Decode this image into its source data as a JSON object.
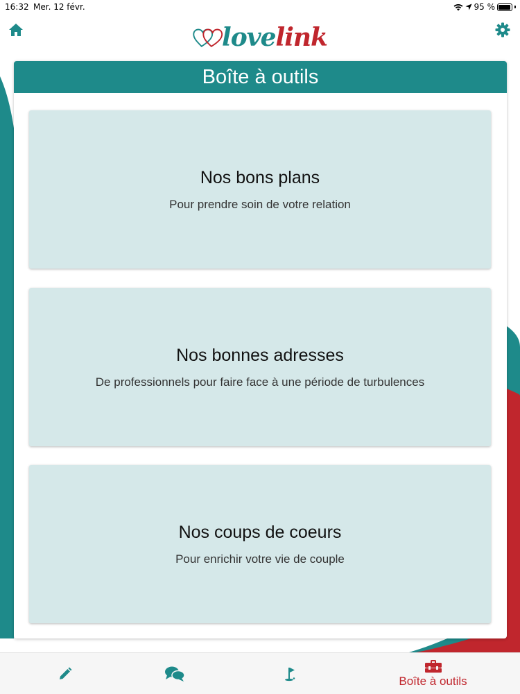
{
  "status_bar": {
    "time": "16:32",
    "date": "Mer. 12 févr.",
    "battery": "95 %",
    "battery_level": 0.95
  },
  "header": {
    "logo_love": "love",
    "logo_link": "link",
    "icons": {
      "left": "home-icon",
      "right": "gear-icon"
    }
  },
  "panel": {
    "title": "Boîte à outils"
  },
  "cards": [
    {
      "title": "Nos bons plans",
      "subtitle": "Pour prendre soin de votre relation"
    },
    {
      "title": "Nos bonnes adresses",
      "subtitle": "De professionnels pour faire face à une période de turbulences"
    },
    {
      "title": "Nos coups de coeurs",
      "subtitle": "Pour enrichir votre vie de couple"
    }
  ],
  "tabbar": {
    "tabs": [
      {
        "icon": "pencil-icon",
        "label": ""
      },
      {
        "icon": "chat-icon",
        "label": ""
      },
      {
        "icon": "golf-flag-icon",
        "label": ""
      },
      {
        "icon": "toolbox-icon",
        "label": "Boîte à outils",
        "active": true
      }
    ]
  },
  "colors": {
    "teal": "#1e8a8a",
    "red": "#c0262d",
    "card_bg": "#d5e8e9"
  }
}
